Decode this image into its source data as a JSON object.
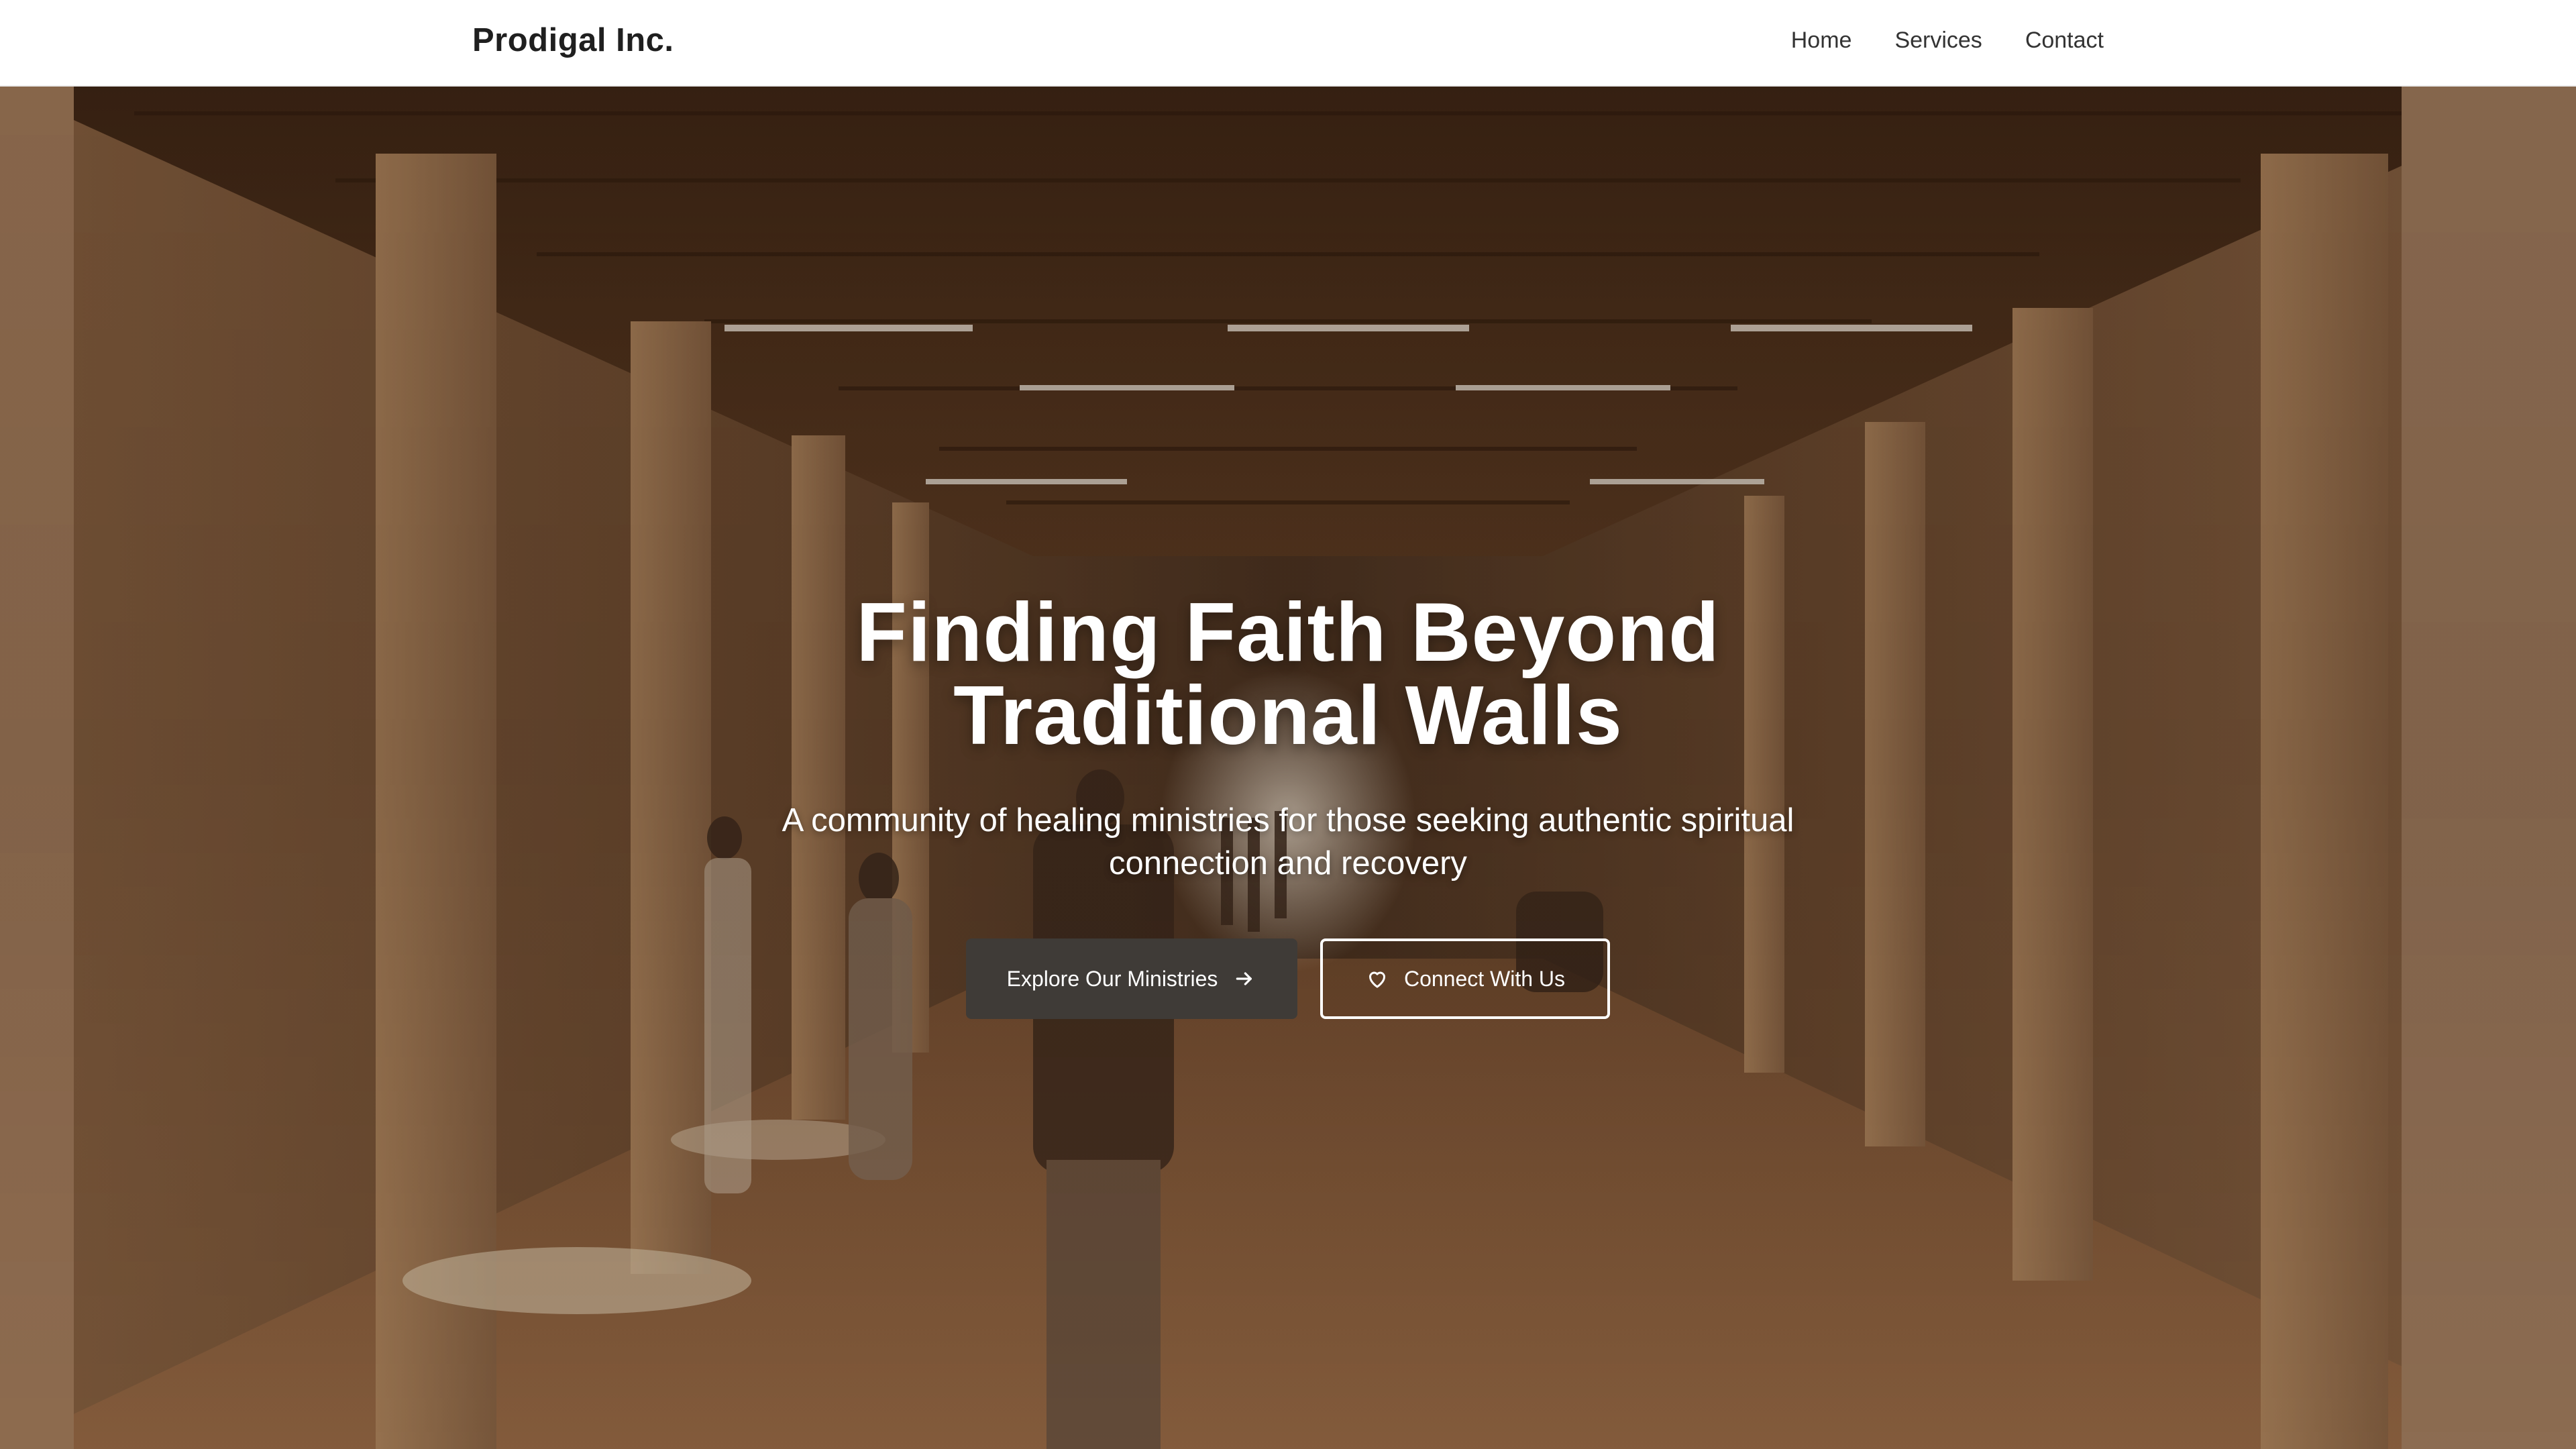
{
  "navbar": {
    "brand": "Prodigal Inc.",
    "links": [
      {
        "label": "Home"
      },
      {
        "label": "Services"
      },
      {
        "label": "Contact"
      }
    ]
  },
  "hero": {
    "title": "Finding Faith Beyond Traditional Walls",
    "subtitle": "A community of healing ministries for those seeking authentic spiritual connection and recovery",
    "primary_button": {
      "label": "Explore Our Ministries",
      "icon": "arrow-right-icon"
    },
    "secondary_button": {
      "label": "Connect With Us",
      "icon": "heart-icon"
    }
  },
  "colors": {
    "primary_button_bg": "#3f3b37",
    "text_on_hero": "#ffffff",
    "brand_text": "#1f1f1f"
  }
}
